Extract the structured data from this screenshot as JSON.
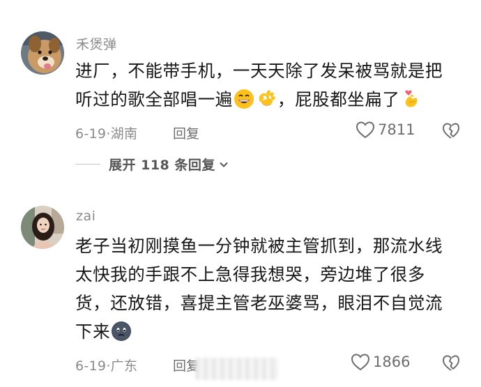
{
  "comments": [
    {
      "username": "禾煲弹",
      "lines": [
        "进厂，不能带手机，一天天除了发呆被骂就是把",
        "听过的歌全部唱一遍",
        "，屁股都坐扁了"
      ],
      "emojis": [
        "grinning-face-emoji",
        "ok-hand-emoji",
        "finger-heart-emoji"
      ],
      "date": "6-19",
      "location": "湖南",
      "reply_label": "回复",
      "likes": "7811",
      "expand_label": "展开 118 条回复"
    },
    {
      "username": "zai",
      "lines": [
        "老子当初刚摸鱼一分钟就被主管抓到，那流水线",
        "太快我的手跟不上急得我想哭，旁边堆了很多",
        "货，还放错，喜提主管老巫婆骂，眼泪不自觉流",
        "下来"
      ],
      "emojis": [
        "dark-face-emoji"
      ],
      "date": "6-19",
      "location": "广东",
      "reply_label": "回复",
      "likes": "1866"
    }
  ],
  "separator": "·",
  "colors": {
    "text": "#161616",
    "meta": "#8a8a8a",
    "background": "#ffffff"
  }
}
